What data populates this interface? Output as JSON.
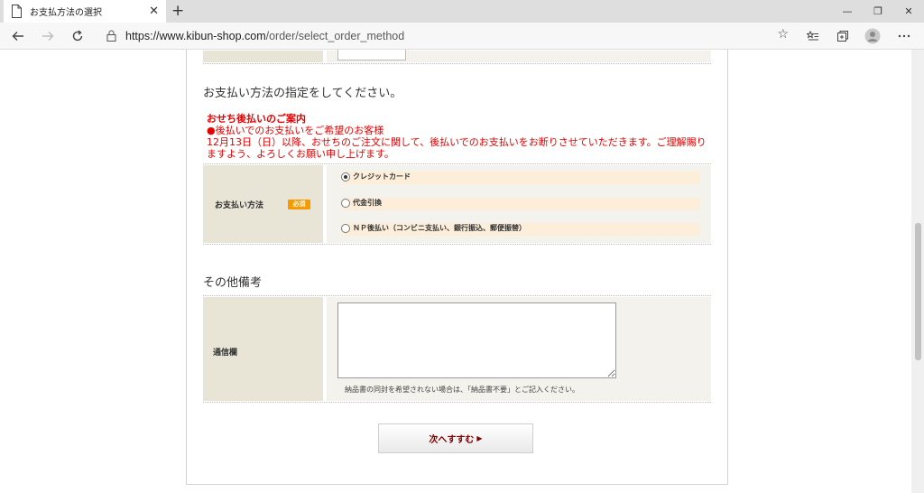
{
  "browser": {
    "tab_title": "お支払方法の選択",
    "tab_close": "✕",
    "new_tab": "+",
    "url_host": "https://www.kibun-shop.com",
    "url_path": "/order/select_order_method",
    "window_controls": [
      "—",
      "❐",
      "✕"
    ],
    "toolbar_icons": [
      "star-icon",
      "favorites-icon",
      "collections-icon",
      "profile-avatar",
      "more-menu-icon"
    ]
  },
  "payment": {
    "heading": "お支払い方法の指定をしてください。",
    "notice_title": "おせち後払いのご案内",
    "notice_line1": "●後払いでのお支払いをご希望のお客様",
    "notice_line2": "12月13日（日）以降、おせちのご注文に関して、後払いでのお支払いをお断りさせていただきます。ご理解賜りますよう、よろしくお願い申し上げます。",
    "label": "お支払い方法",
    "required": "必須",
    "options": [
      {
        "label": "クレジットカード",
        "selected": true
      },
      {
        "label": "代金引換",
        "selected": false
      },
      {
        "label": "ＮＰ後払い（コンビニ支払い、銀行振込、郵便振替）",
        "selected": false
      }
    ]
  },
  "remarks": {
    "heading": "その他備考",
    "label": "通信欄",
    "textarea_value": "",
    "note": "納品書の同封を希望されない場合は、「納品書不要」とご記入ください。"
  },
  "next_button": {
    "label": "次へすすむ",
    "arrow": "▶"
  },
  "colors": {
    "notice": "#e60000",
    "button_text": "#7b0000",
    "required_badge": "#f59a00",
    "label_bg": "#e8e5d6",
    "option_bg": "#fdeeda"
  }
}
